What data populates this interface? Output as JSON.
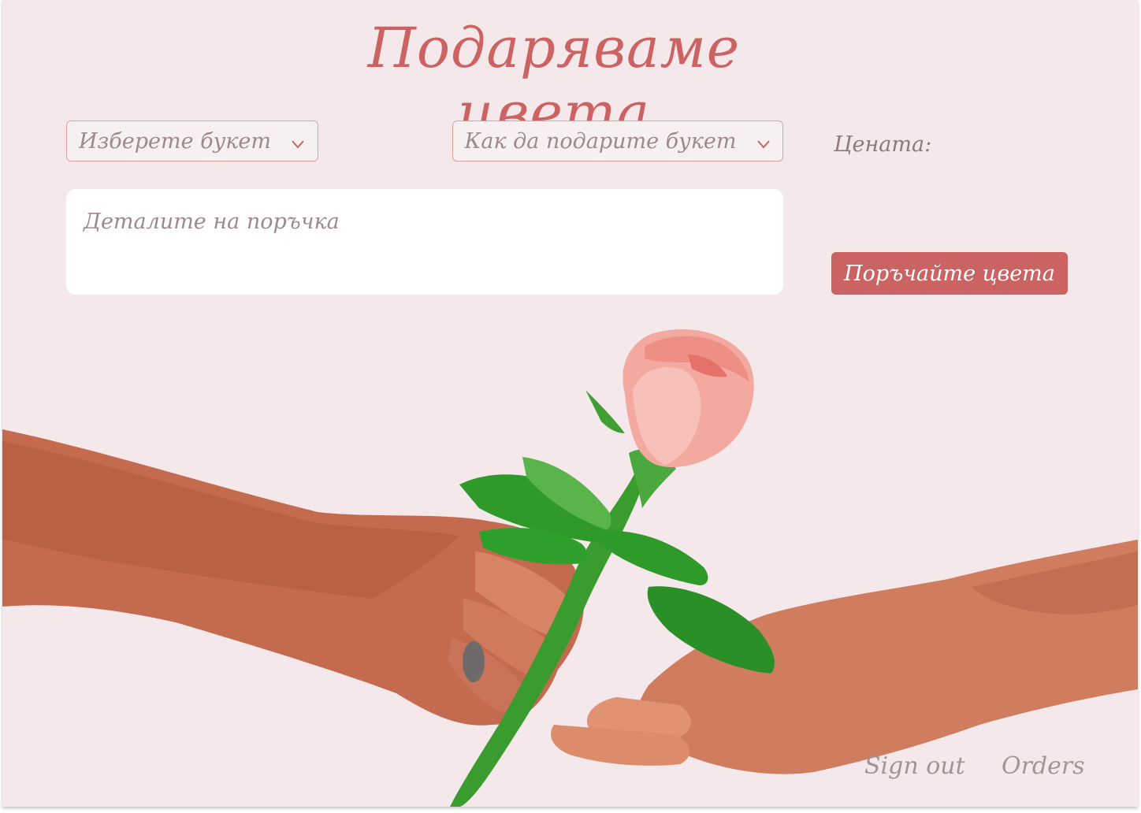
{
  "header": {
    "title": "Подаряваме цвета"
  },
  "form": {
    "bouquet_select": {
      "label": "Изберете букет",
      "icon": "chevron-down-icon"
    },
    "gift_select": {
      "label": "Как да подарите букет",
      "icon": "chevron-down-icon"
    },
    "price_label": "Цената:",
    "details_placeholder": "Деталите на поръчка",
    "order_button": "Поръчайте цвета"
  },
  "footer": {
    "sign_out": "Sign out",
    "orders": "Orders"
  },
  "colors": {
    "accent": "#cc6363",
    "background": "#f5e8ea",
    "muted_text": "#9c8a8a"
  }
}
